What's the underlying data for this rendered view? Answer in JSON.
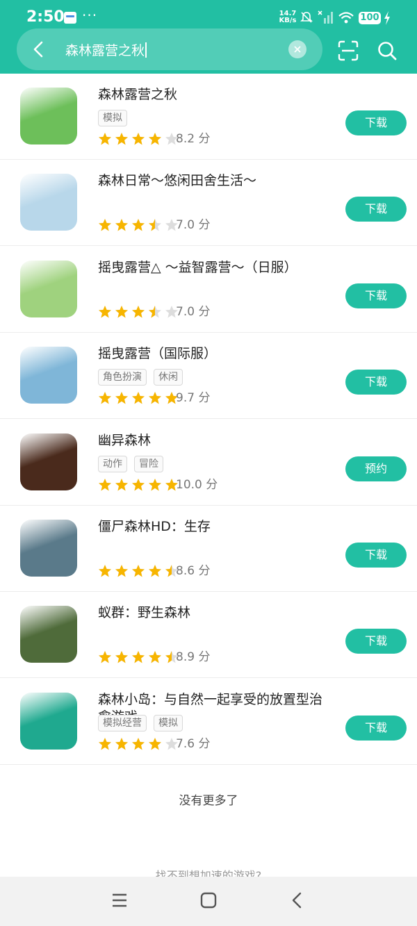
{
  "status_bar": {
    "time": "2:50",
    "dots": "···",
    "speed_value": "14.7",
    "speed_unit": "KB/s",
    "battery": "100"
  },
  "search": {
    "query": "森林露营之秋",
    "clear_icon": "clear-icon",
    "scan_icon": "scan-icon",
    "search_icon": "search-icon"
  },
  "results": [
    {
      "name": "森林露营之秋",
      "tags": [
        "模拟"
      ],
      "rating": 4,
      "score": "8.2 分",
      "button": "下载",
      "icon_color": "#6dbf5a"
    },
    {
      "name": "森林日常～悠闲田舍生活～",
      "tags": [],
      "rating": 3.5,
      "score": "7.0 分",
      "button": "下载",
      "icon_color": "#b8d7ea"
    },
    {
      "name": "摇曳露营△ ～益智露营～（日服）",
      "tags": [],
      "rating": 3.5,
      "score": "7.0 分",
      "button": "下载",
      "icon_color": "#9fd27e"
    },
    {
      "name": "摇曳露营（国际服）",
      "tags": [
        "角色扮演",
        "休闲"
      ],
      "rating": 5,
      "score": "9.7 分",
      "button": "下载",
      "icon_color": "#7fb6d8"
    },
    {
      "name": "幽异森林",
      "tags": [
        "动作",
        "冒险"
      ],
      "rating": 5,
      "score": "10.0 分",
      "button": "预约",
      "icon_color": "#4a2a1c"
    },
    {
      "name": "僵尸森林HD：生存",
      "tags": [],
      "rating": 4.5,
      "score": "8.6 分",
      "button": "下载",
      "icon_color": "#5a7a8a"
    },
    {
      "name": "蚁群：野生森林",
      "tags": [],
      "rating": 4.5,
      "score": "8.9 分",
      "button": "下载",
      "icon_color": "#4f6b3a"
    },
    {
      "name": "森林小岛：与自然一起享受的放置型治愈游戏",
      "tags": [
        "模拟经营",
        "模拟"
      ],
      "rating": 4,
      "score": "7.6 分",
      "button": "下载",
      "icon_color": "#1fa98f"
    }
  ],
  "footer": {
    "no_more": "没有更多了",
    "hint": "找不到想加速的游戏?"
  },
  "colors": {
    "accent": "#22bfa3",
    "star": "#f7b500",
    "star_empty": "#dddddd"
  }
}
